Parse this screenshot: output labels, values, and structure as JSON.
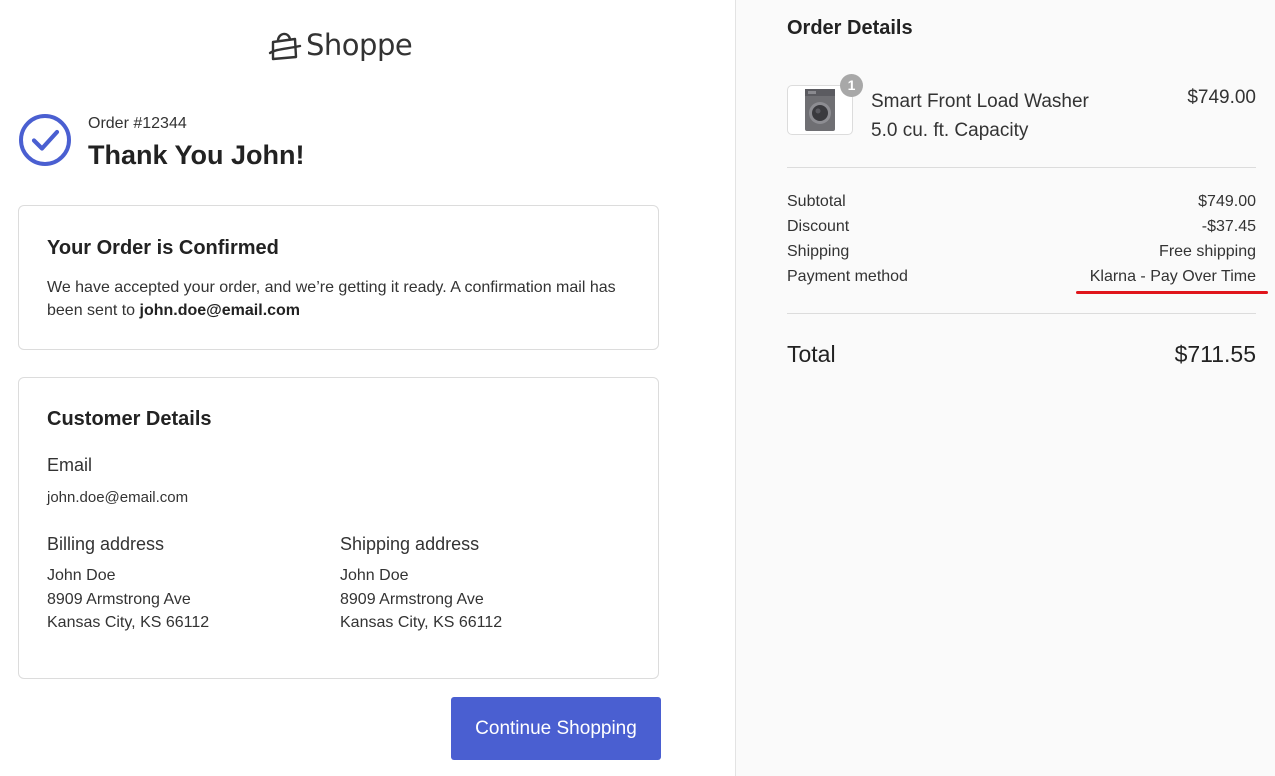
{
  "brand": {
    "name": "Shoppe",
    "logo_icon": "shopping-bag-icon"
  },
  "header": {
    "order_number": "Order #12344",
    "thanks": "Thank You John!",
    "status_icon": "check-circle-icon"
  },
  "confirmation": {
    "title": "Your Order is Confirmed",
    "message": "We have accepted your order, and we’re getting it ready. A confirmation mail has been sent to ",
    "email": "john.doe@email.com"
  },
  "customer": {
    "title": "Customer Details",
    "email_label": "Email",
    "email": "john.doe@email.com",
    "billing": {
      "label": "Billing address",
      "name": "John Doe",
      "street": "8909 Armstrong Ave",
      "city": "Kansas City, KS 66112"
    },
    "shipping": {
      "label": "Shipping address",
      "name": "John Doe",
      "street": "8909 Armstrong Ave",
      "city": "Kansas City, KS 66112"
    }
  },
  "actions": {
    "continue_label": "Continue Shopping"
  },
  "order": {
    "title": "Order Details",
    "item": {
      "quantity": "1",
      "name_line1": "Smart Front Load Washer",
      "name_line2": "5.0 cu. ft. Capacity",
      "price": "$749.00",
      "thumbnail_icon": "washing-machine-icon"
    },
    "summary": [
      {
        "label": "Subtotal",
        "value": "$749.00"
      },
      {
        "label": "Discount",
        "value": "-$37.45"
      },
      {
        "label": "Shipping",
        "value": "Free shipping"
      },
      {
        "label": "Payment method",
        "value": "Klarna - Pay Over Time"
      }
    ],
    "total_label": "Total",
    "total_value": "$711.55"
  },
  "colors": {
    "primary": "#4a5fd1",
    "check": "#4a5fd1",
    "highlight_underline": "#e0151b",
    "right_panel_bg": "#fafafa"
  }
}
